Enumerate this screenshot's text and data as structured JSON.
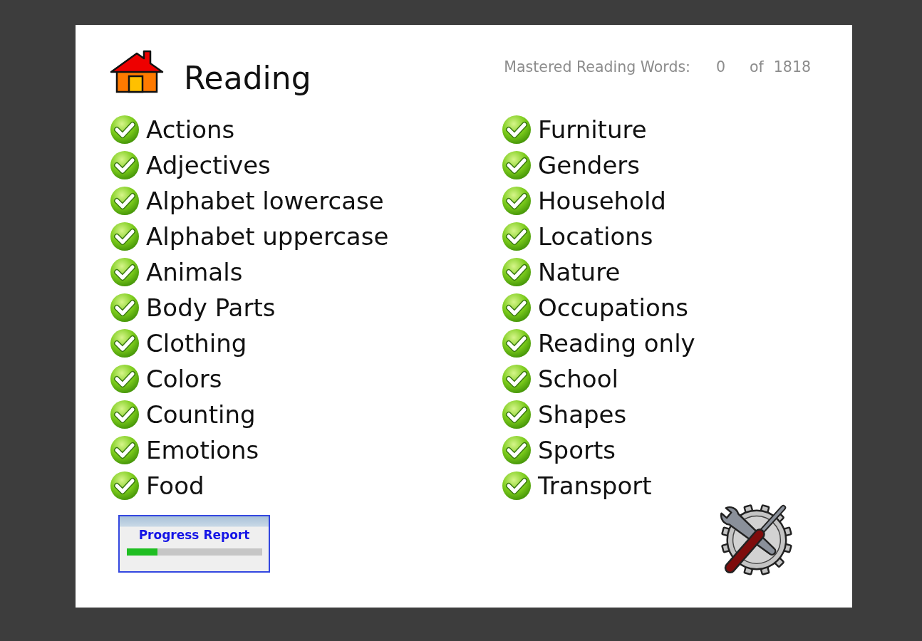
{
  "header": {
    "title": "Reading",
    "stats": {
      "label": "Mastered Reading Words:",
      "mastered": "0",
      "separator": "of",
      "total": "1818"
    }
  },
  "category_columns": [
    {
      "items": [
        {
          "label": "Actions",
          "checked": true
        },
        {
          "label": "Adjectives",
          "checked": true
        },
        {
          "label": "Alphabet lowercase",
          "checked": true
        },
        {
          "label": "Alphabet uppercase",
          "checked": true
        },
        {
          "label": "Animals",
          "checked": true
        },
        {
          "label": "Body Parts",
          "checked": true
        },
        {
          "label": "Clothing",
          "checked": true
        },
        {
          "label": "Colors",
          "checked": true
        },
        {
          "label": "Counting",
          "checked": true
        },
        {
          "label": "Emotions",
          "checked": true
        },
        {
          "label": "Food",
          "checked": true
        }
      ]
    },
    {
      "items": [
        {
          "label": "Furniture",
          "checked": true
        },
        {
          "label": "Genders",
          "checked": true
        },
        {
          "label": "Household",
          "checked": true
        },
        {
          "label": "Locations",
          "checked": true
        },
        {
          "label": "Nature",
          "checked": true
        },
        {
          "label": "Occupations",
          "checked": true
        },
        {
          "label": "Reading only",
          "checked": true
        },
        {
          "label": "School",
          "checked": true
        },
        {
          "label": "Shapes",
          "checked": true
        },
        {
          "label": "Sports",
          "checked": true
        },
        {
          "label": "Transport",
          "checked": true
        }
      ]
    }
  ],
  "progress_report": {
    "label": "Progress Report",
    "level": 0.23
  }
}
